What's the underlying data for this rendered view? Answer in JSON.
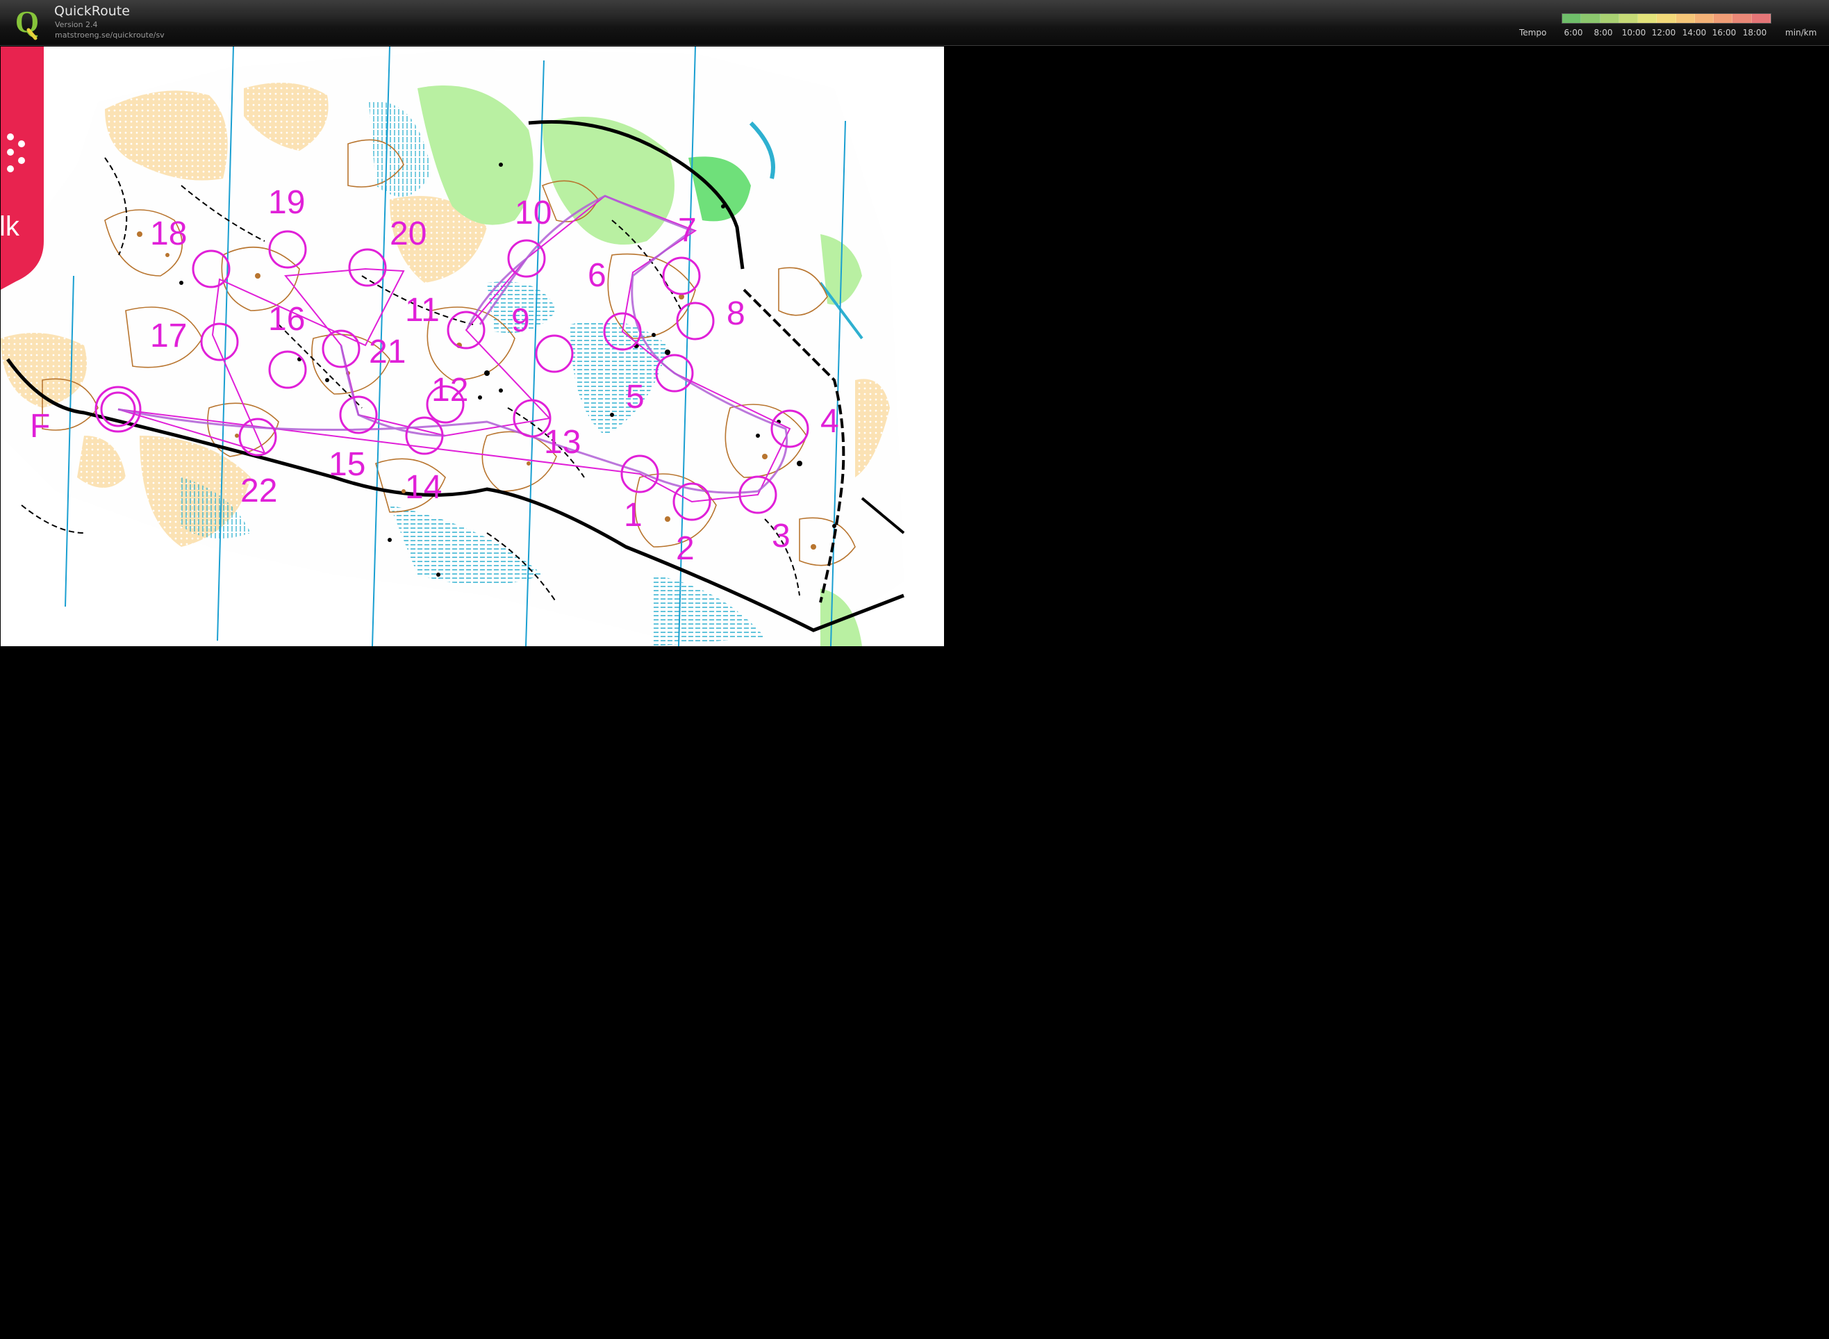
{
  "app": {
    "title": "QuickRoute",
    "version": "Version 2.4",
    "url": "matstroeng.se/quickroute/sv",
    "logo_letter": "Q"
  },
  "legend": {
    "label": "Tempo",
    "unit": "min/km",
    "ticks": [
      "6:00",
      "8:00",
      "10:00",
      "12:00",
      "14:00",
      "16:00",
      "18:00"
    ],
    "colors": [
      "#6fbf6a",
      "#8cc86e",
      "#a9d172",
      "#c6da76",
      "#e3e37a",
      "#f2d979",
      "#f5c678",
      "#f4b277",
      "#f09d76",
      "#ea8877",
      "#e57577"
    ]
  },
  "map": {
    "controls": [
      "1",
      "2",
      "3",
      "4",
      "5",
      "6",
      "7",
      "8",
      "9",
      "10",
      "11",
      "12",
      "13",
      "14",
      "15",
      "16",
      "17",
      "18",
      "19",
      "20",
      "21",
      "22"
    ],
    "finish_label": "F",
    "route_color": "#b05fd6",
    "course_color": "#e020d8",
    "banner_color": "#e8234f",
    "banner_text": "lk"
  }
}
